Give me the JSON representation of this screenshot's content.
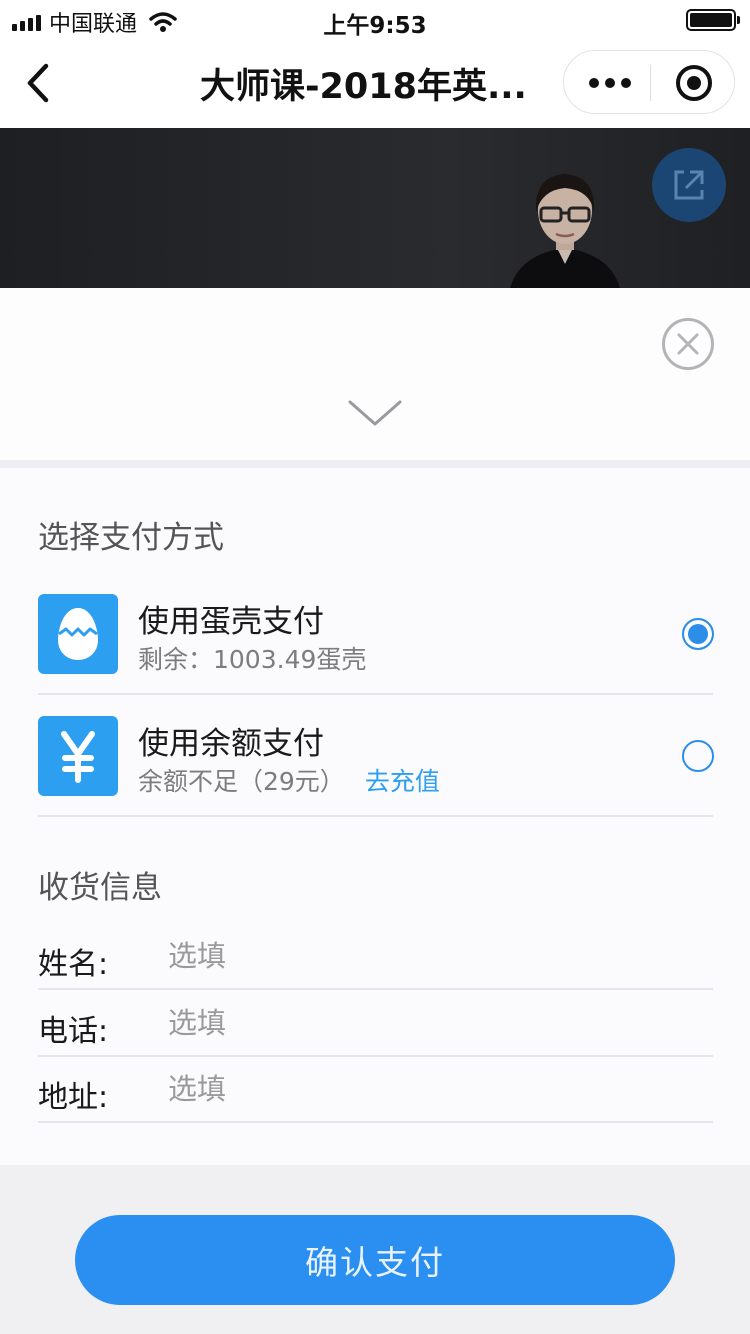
{
  "status_bar": {
    "carrier": "中国联通",
    "time": "上午9:53"
  },
  "nav": {
    "title": "大师课-2018年英..."
  },
  "payment": {
    "section_title": "选择支付方式",
    "options": [
      {
        "title": "使用蛋壳支付",
        "subtitle": "剩余：1003.49蛋壳",
        "selected": true,
        "icon": "egg-icon"
      },
      {
        "title": "使用余额支付",
        "subtitle": "余额不足（29元）",
        "link": "去充值",
        "selected": false,
        "icon": "yen-icon"
      }
    ]
  },
  "shipping": {
    "section_title": "收货信息",
    "fields": [
      {
        "label": "姓名:",
        "placeholder": "选填"
      },
      {
        "label": "电话:",
        "placeholder": "选填"
      },
      {
        "label": "地址:",
        "placeholder": "选填"
      }
    ]
  },
  "footer": {
    "confirm_label": "确认支付"
  },
  "colors": {
    "accent": "#2d8eea",
    "icon_bg": "#2d9ff0",
    "button_bg": "#2a8ff0"
  }
}
